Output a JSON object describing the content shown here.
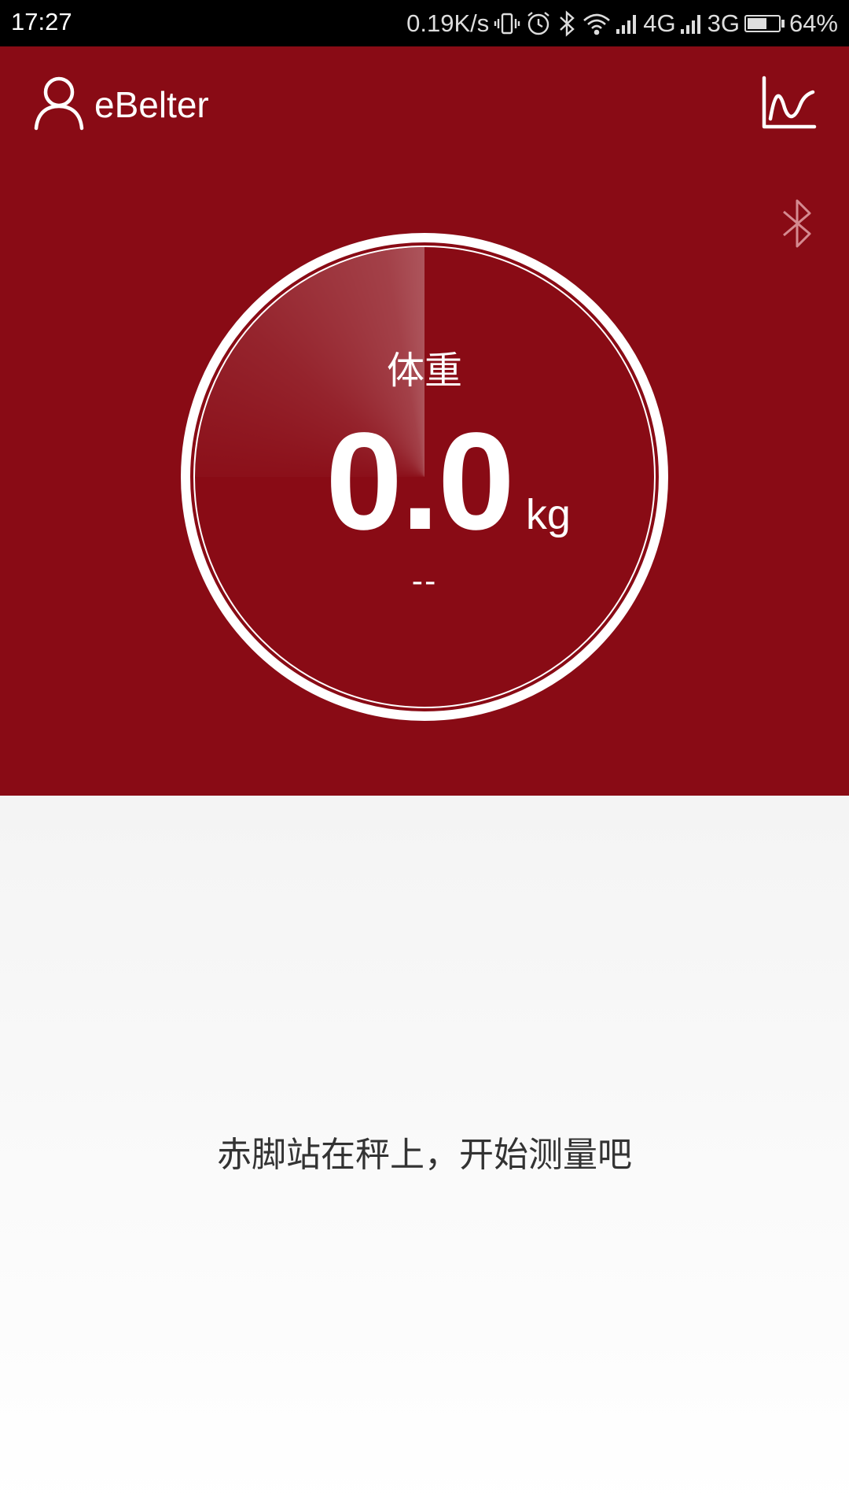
{
  "status_bar": {
    "time": "17:27",
    "net_speed": "0.19K/s",
    "signal_1_label": "4G",
    "signal_2_label": "3G",
    "battery_text": "64%",
    "battery_level": 0.64,
    "icons": [
      "vibrate-icon",
      "alarm-icon",
      "bluetooth-icon",
      "wifi-icon",
      "cell-signal-icon",
      "battery-icon"
    ]
  },
  "header": {
    "app_name": "eBelter",
    "profile_icon": "user-icon",
    "trend_icon": "line-chart-icon",
    "bluetooth_icon": "bluetooth-icon"
  },
  "gauge": {
    "label": "体重",
    "value": "0.0",
    "unit": "kg",
    "sub": "--"
  },
  "hint": "赤脚站在秤上，开始测量吧",
  "colors": {
    "primary": "#890b15",
    "background": "#f4f4f4",
    "text": "#333333"
  }
}
